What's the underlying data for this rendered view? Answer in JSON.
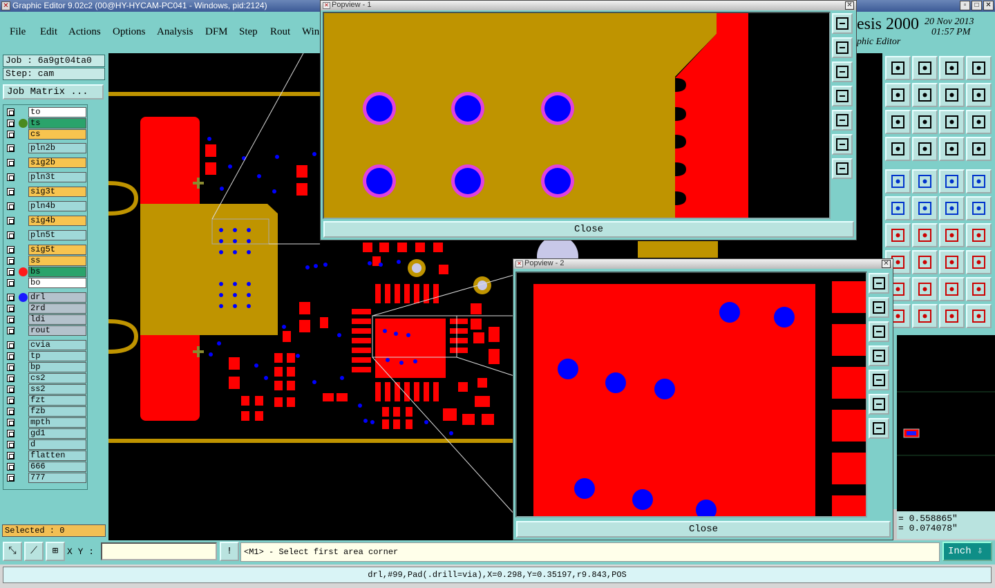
{
  "window": {
    "title": "Graphic Editor 9.02c2 (00@HY-HYCAM-PC041 - Windows, pid:2124)"
  },
  "menu": [
    "File",
    "Edit",
    "Actions",
    "Options",
    "Analysis",
    "DFM",
    "Step",
    "Rout",
    "Win"
  ],
  "brand": {
    "name": "esis 2000",
    "subtitle": "phic Editor",
    "date": "20 Nov 2013",
    "time": "01:57 PM"
  },
  "job": {
    "job_line": "Job : 6a9gt04ta0",
    "step_line": "Step: cam",
    "matrix_button": "Job Matrix ..."
  },
  "layers": [
    {
      "name": "to",
      "color": "#ffffff"
    },
    {
      "name": "ts",
      "color": "#2aa36b",
      "dot": "#4a8a1e"
    },
    {
      "name": "cs",
      "color": "#f7c44f"
    },
    {
      "name": "pln2b",
      "color": "#9fd8d8"
    },
    {
      "name": "sig2b",
      "color": "#f7c44f"
    },
    {
      "name": "pln3t",
      "color": "#9fd8d8"
    },
    {
      "name": "sig3t",
      "color": "#f7c44f"
    },
    {
      "name": "pln4b",
      "color": "#9fd8d8"
    },
    {
      "name": "sig4b",
      "color": "#f7c44f"
    },
    {
      "name": "pln5t",
      "color": "#9fd8d8"
    },
    {
      "name": "sig5t",
      "color": "#f7c44f"
    },
    {
      "name": "ss",
      "color": "#f7c44f"
    },
    {
      "name": "bs",
      "color": "#2aa36b",
      "dot": "#ff1a1a"
    },
    {
      "name": "bo",
      "color": "#ffffff"
    },
    {
      "name": "drl",
      "color": "#b4c2cc",
      "dot": "#1a1aff"
    },
    {
      "name": "2rd",
      "color": "#b4c2cc"
    },
    {
      "name": "ldi",
      "color": "#b4c2cc"
    },
    {
      "name": "rout",
      "color": "#b4c2cc"
    },
    {
      "name": "cvia",
      "color": "#9fd8d8"
    },
    {
      "name": "tp",
      "color": "#9fd8d8"
    },
    {
      "name": "bp",
      "color": "#9fd8d8"
    },
    {
      "name": "cs2",
      "color": "#9fd8d8"
    },
    {
      "name": "ss2",
      "color": "#9fd8d8"
    },
    {
      "name": "fzt",
      "color": "#9fd8d8"
    },
    {
      "name": "fzb",
      "color": "#9fd8d8"
    },
    {
      "name": "mpth",
      "color": "#9fd8d8"
    },
    {
      "name": "gd1",
      "color": "#9fd8d8"
    },
    {
      "name": "d",
      "color": "#9fd8d8"
    },
    {
      "name": "flatten",
      "color": "#9fd8d8"
    },
    {
      "name": "666",
      "color": "#9fd8d8"
    },
    {
      "name": "777",
      "color": "#9fd8d8"
    }
  ],
  "selected": "Selected : 0",
  "popview1": {
    "title": "Popview - 1",
    "close": "Close"
  },
  "popview2": {
    "title": "Popview - 2",
    "close": "Close"
  },
  "coords": {
    "x": "= 0.558865\"",
    "y": "= 0.074078\""
  },
  "xy_label": "X Y :",
  "message": "<M1> - Select first area corner",
  "unit": "Inch",
  "status": "drl,#99,Pad(.drill=via),X=0.298,Y=0.35197,r9.843,POS",
  "colors": {
    "pad": "#ff0000",
    "copper": "#bf9400",
    "via": "#0000ff",
    "bg": "#000000",
    "panel": "#7fcfc9"
  }
}
